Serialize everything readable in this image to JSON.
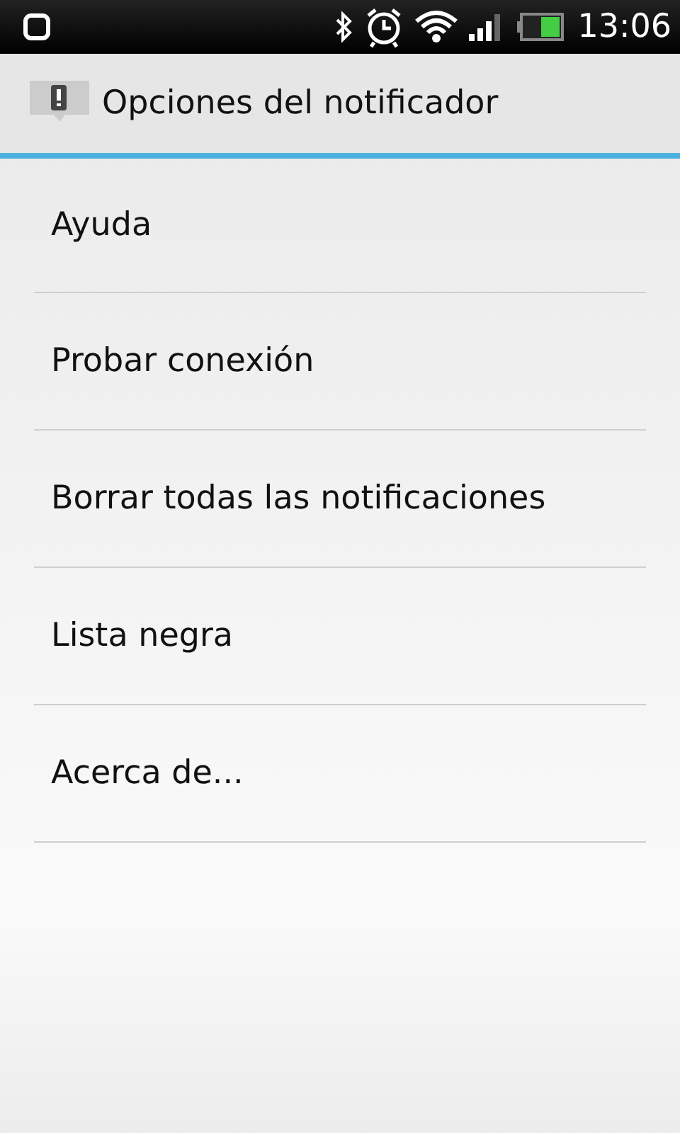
{
  "status_bar": {
    "time": "13:06"
  },
  "title_bar": {
    "title": "Opciones del notificador"
  },
  "menu": [
    {
      "label": "Ayuda"
    },
    {
      "label": "Probar conexión"
    },
    {
      "label": "Borrar todas las notificaciones"
    },
    {
      "label": "Lista negra"
    },
    {
      "label": "Acerca de..."
    }
  ]
}
